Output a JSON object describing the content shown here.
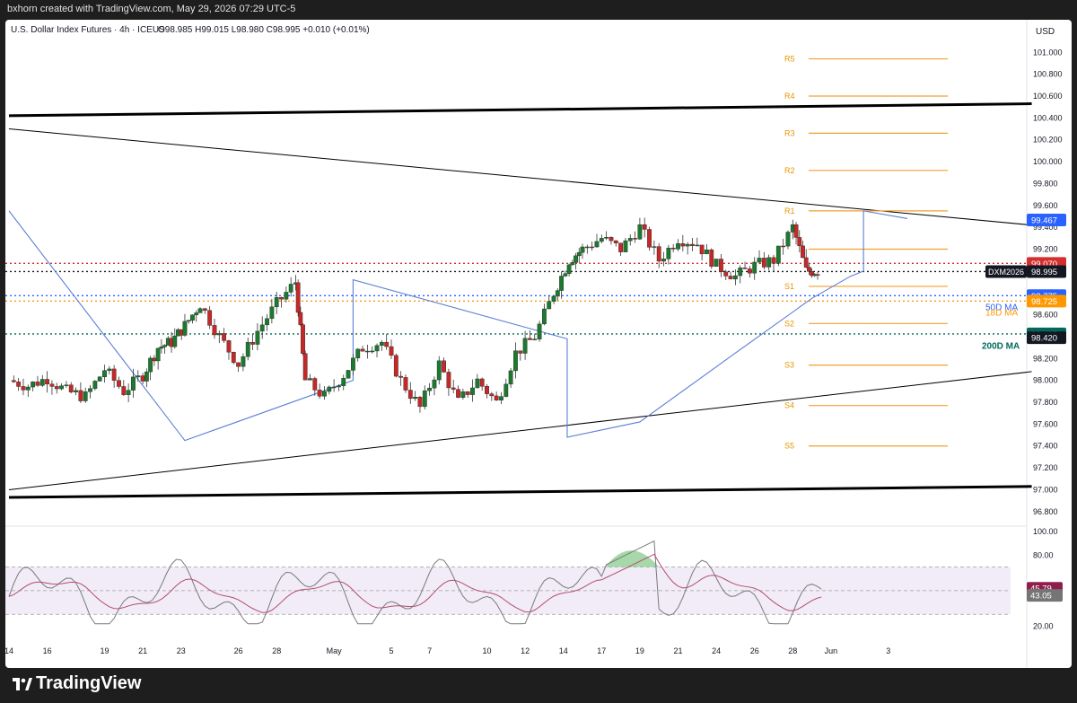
{
  "header": {
    "credit": "bxhorn created with TradingView.com, May 29, 2026 07:29 UTC-5"
  },
  "footer": {
    "brand": "TradingView"
  },
  "chart_data": {
    "type": "candlestick",
    "title": "U.S. Dollar Index Futures · 4h · ICEUS",
    "ohlc_readout": {
      "open": "O98.985",
      "high": "H99.015",
      "low": "L98.980",
      "close": "C98.995",
      "change": "+0.010 (+0.01%)"
    },
    "currency": "USD",
    "ylim": [
      96.7,
      101.15
    ],
    "yticks": [
      "101.000",
      "100.800",
      "100.600",
      "100.400",
      "100.200",
      "100.000",
      "99.800",
      "99.600",
      "99.400",
      "99.200",
      "99.000",
      "98.800",
      "98.600",
      "98.400",
      "98.200",
      "98.000",
      "97.800",
      "97.600",
      "97.400",
      "97.200",
      "97.000",
      "96.800"
    ],
    "xlim": [
      0,
      35
    ],
    "xticks": [
      {
        "x": 0,
        "label": "14"
      },
      {
        "x": 2,
        "label": "16"
      },
      {
        "x": 5,
        "label": "19"
      },
      {
        "x": 7,
        "label": "21"
      },
      {
        "x": 9,
        "label": "23"
      },
      {
        "x": 12,
        "label": "26"
      },
      {
        "x": 14,
        "label": "28"
      },
      {
        "x": 17,
        "label": "May"
      },
      {
        "x": 20,
        "label": "5"
      },
      {
        "x": 22,
        "label": "7"
      },
      {
        "x": 25,
        "label": "10"
      },
      {
        "x": 27,
        "label": "12"
      },
      {
        "x": 29,
        "label": "14"
      },
      {
        "x": 31,
        "label": "17"
      },
      {
        "x": 33,
        "label": "19"
      },
      {
        "x": 35,
        "label": "21"
      },
      {
        "x": 37,
        "label": "24"
      },
      {
        "x": 39,
        "label": "26"
      },
      {
        "x": 41,
        "label": "28"
      },
      {
        "x": 43,
        "label": "Jun"
      },
      {
        "x": 46,
        "label": "3"
      }
    ],
    "candles_close_path": [
      {
        "x": 0,
        "c": 98.0
      },
      {
        "x": 1,
        "c": 97.95
      },
      {
        "x": 2,
        "c": 98.02
      },
      {
        "x": 3,
        "c": 97.9
      },
      {
        "x": 4,
        "c": 97.85
      },
      {
        "x": 5,
        "c": 98.1
      },
      {
        "x": 6,
        "c": 97.9
      },
      {
        "x": 7,
        "c": 98.05
      },
      {
        "x": 7.8,
        "c": 98.3
      },
      {
        "x": 8.5,
        "c": 98.35
      },
      {
        "x": 9.2,
        "c": 98.5
      },
      {
        "x": 10,
        "c": 98.7
      },
      {
        "x": 11,
        "c": 98.4
      },
      {
        "x": 12,
        "c": 98.15
      },
      {
        "x": 13,
        "c": 98.45
      },
      {
        "x": 14,
        "c": 98.7
      },
      {
        "x": 15,
        "c": 98.9
      },
      {
        "x": 15.5,
        "c": 98.0
      },
      {
        "x": 16.5,
        "c": 97.85
      },
      {
        "x": 17.5,
        "c": 98.05
      },
      {
        "x": 18.5,
        "c": 98.3
      },
      {
        "x": 19.5,
        "c": 98.35
      },
      {
        "x": 20.5,
        "c": 98.0
      },
      {
        "x": 21.5,
        "c": 97.75
      },
      {
        "x": 22.5,
        "c": 98.15
      },
      {
        "x": 23.5,
        "c": 97.8
      },
      {
        "x": 24.5,
        "c": 98.0
      },
      {
        "x": 25.5,
        "c": 97.8
      },
      {
        "x": 26.5,
        "c": 98.25
      },
      {
        "x": 27.5,
        "c": 98.4
      },
      {
        "x": 28.5,
        "c": 98.8
      },
      {
        "x": 29.3,
        "c": 99.1
      },
      {
        "x": 30,
        "c": 99.2
      },
      {
        "x": 31,
        "c": 99.3
      },
      {
        "x": 32,
        "c": 99.2
      },
      {
        "x": 33,
        "c": 99.4
      },
      {
        "x": 34,
        "c": 99.1
      },
      {
        "x": 35,
        "c": 99.3
      },
      {
        "x": 36,
        "c": 99.25
      },
      {
        "x": 37,
        "c": 99.05
      },
      {
        "x": 38,
        "c": 98.95
      },
      {
        "x": 39,
        "c": 99.05
      },
      {
        "x": 40,
        "c": 99.1
      },
      {
        "x": 41,
        "c": 99.4
      },
      {
        "x": 41.7,
        "c": 99.0
      },
      {
        "x": 42.3,
        "c": 99.0
      }
    ],
    "moving_average": {
      "color": "#5b7fd6",
      "last_label": "99.467"
    },
    "horizontal_lines": [
      {
        "label": "99.070",
        "value": 99.07,
        "color": "#d32f2f",
        "style": "dotted"
      },
      {
        "label": "DXM2026",
        "value": 98.995,
        "color": "#1a1a1a",
        "style": "dotted",
        "price": "98.995"
      },
      {
        "label": "98.775",
        "value": 98.775,
        "color": "#2962ff",
        "style": "dotted"
      },
      {
        "label": "98.725",
        "value": 98.725,
        "color": "#ff9800",
        "style": "dotted"
      },
      {
        "label": "98.425",
        "value": 98.425,
        "color": "#00695c",
        "style": "dotted"
      },
      {
        "label": "98.420",
        "value": 98.42,
        "color": "#1a1a1a",
        "style": "none"
      }
    ],
    "ma_labels": {
      "ma50": "50D MA",
      "ma18": "18D MA",
      "ma200": "200D MA"
    },
    "pivots": [
      {
        "label": "R5",
        "value": 100.94
      },
      {
        "label": "R4",
        "value": 100.6
      },
      {
        "label": "R3",
        "value": 100.26
      },
      {
        "label": "R2",
        "value": 99.92
      },
      {
        "label": "R1",
        "value": 99.55
      },
      {
        "label": "",
        "value": 99.2
      },
      {
        "label": "S1",
        "value": 98.86
      },
      {
        "label": "S2",
        "value": 98.52
      },
      {
        "label": "S3",
        "value": 98.14
      },
      {
        "label": "S4",
        "value": 97.77
      },
      {
        "label": "S5",
        "value": 97.4
      }
    ],
    "rsi": {
      "ylim": [
        15,
        100
      ],
      "yticks": [
        "100.00",
        "80.00",
        "20.00"
      ],
      "band": [
        30,
        70
      ],
      "rsi_label": "43.05",
      "signal_label": "45.79"
    }
  }
}
